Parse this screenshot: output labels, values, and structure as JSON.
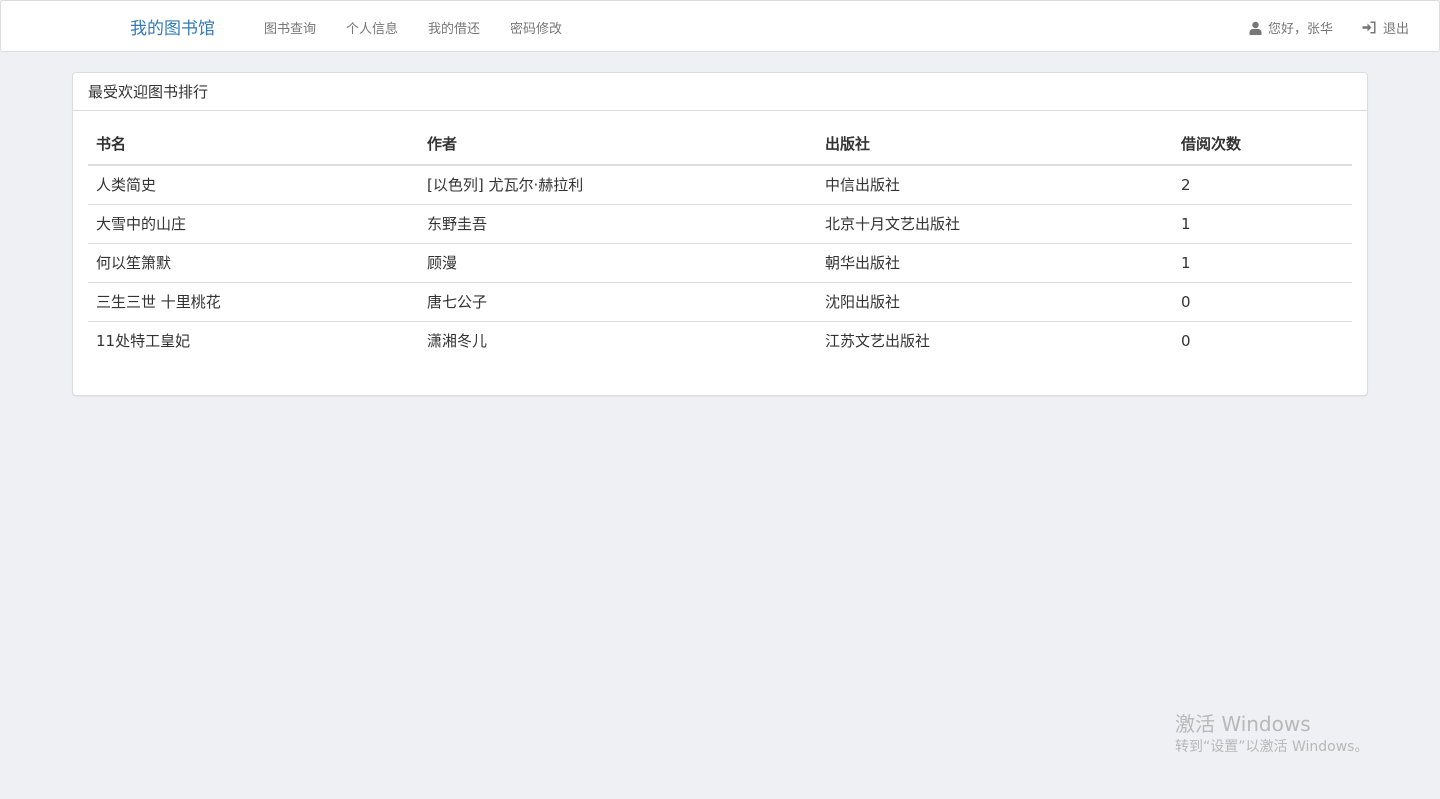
{
  "navbar": {
    "brand": "我的图书馆",
    "links": [
      "图书查询",
      "个人信息",
      "我的借还",
      "密码修改"
    ],
    "greeting": "您好，张华",
    "logout": "退出",
    "brand_color": "#337ab7"
  },
  "panel": {
    "title": "最受欢迎图书排行",
    "table": {
      "headers": [
        "书名",
        "作者",
        "出版社",
        "借阅次数"
      ],
      "rows": [
        [
          "人类简史",
          "[以色列] 尤瓦尔·赫拉利",
          "中信出版社",
          "2"
        ],
        [
          "大雪中的山庄",
          "东野圭吾",
          "北京十月文艺出版社",
          "1"
        ],
        [
          "何以笙箫默",
          "顾漫",
          "朝华出版社",
          "1"
        ],
        [
          "三生三世 十里桃花",
          "唐七公子",
          "沈阳出版社",
          "0"
        ],
        [
          "11处特工皇妃",
          "潇湘冬儿",
          "江苏文艺出版社",
          "0"
        ]
      ]
    }
  },
  "watermark": {
    "title": "激活 Windows",
    "subtitle": "转到“设置”以激活 Windows。"
  },
  "icons": {
    "user": "user-icon",
    "logout": "log-in-icon"
  }
}
